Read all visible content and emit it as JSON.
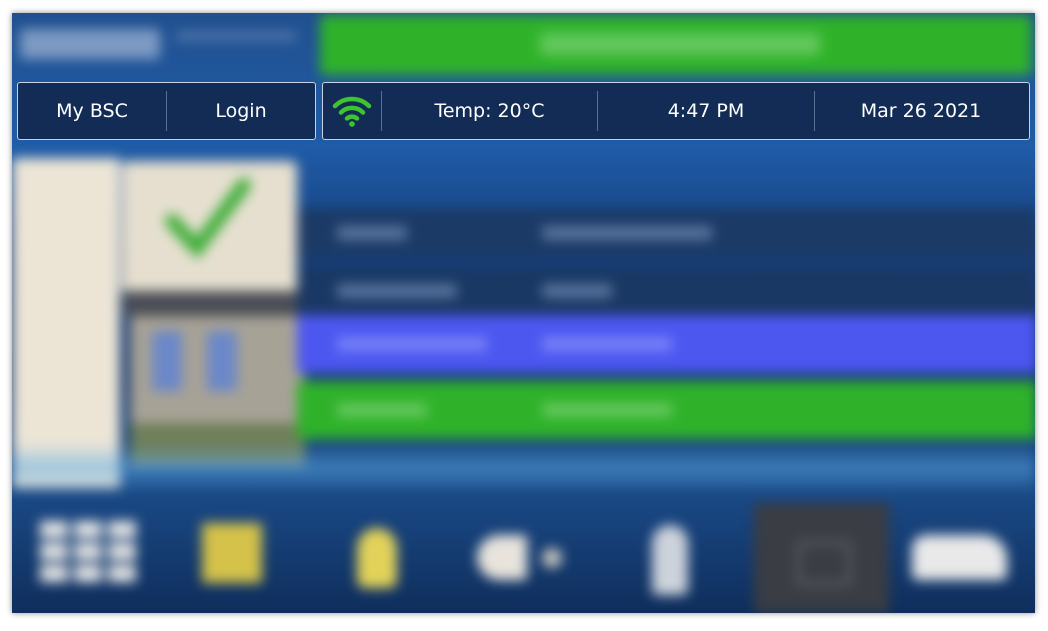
{
  "status_bar": {
    "my_bsc_label": "My BSC",
    "login_label": "Login",
    "wifi_icon": "wifi-icon",
    "wifi_color": "#3ec42f",
    "temperature": "Temp: 20°C",
    "time": "4:47 PM",
    "date": "Mar 26 2021"
  },
  "theme": {
    "banner_color": "#2fb22a",
    "highlight_row_color": "#4c57f0",
    "ok_row_color": "#2fb22a"
  },
  "icons": {
    "status_check": "checkmark-icon",
    "bottom_nav": [
      "grid-icon",
      "display-icon",
      "light-icon",
      "fan-icon",
      "person-icon",
      "screen-icon",
      "car-icon"
    ]
  }
}
